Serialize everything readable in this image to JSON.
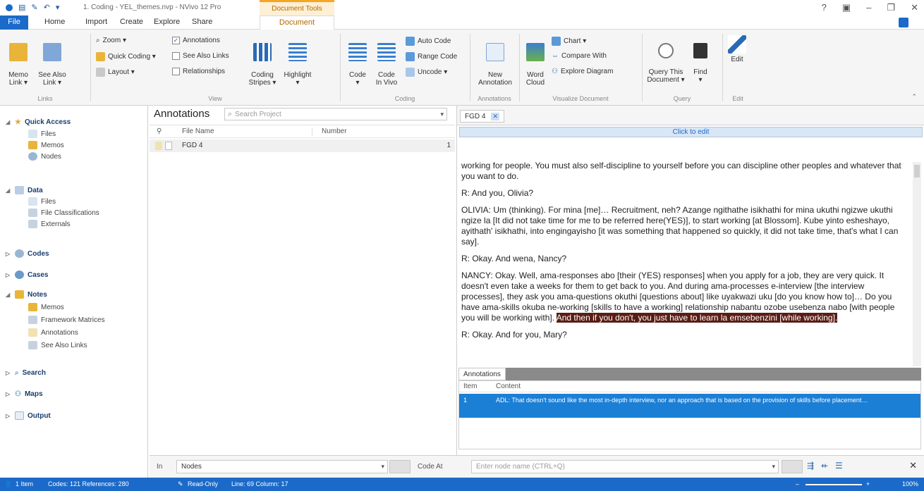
{
  "window": {
    "document_title": "1. Coding - YEL_themes.nvp - NVivo 12 Pro",
    "context_tab": "Document Tools"
  },
  "menu": {
    "file": "File",
    "tabs": [
      "Home",
      "Import",
      "Create",
      "Explore",
      "Share",
      "Document"
    ]
  },
  "ribbon": {
    "links": {
      "memo_link": "Memo\nLink ▾",
      "see_also_link": "See Also\nLink ▾",
      "group": "Links"
    },
    "view": {
      "zoom": "Zoom ▾",
      "quick_coding": "Quick Coding ▾",
      "layout": "Layout ▾",
      "annotations": "Annotations",
      "see_also_links": "See Also Links",
      "relationships": "Relationships",
      "coding_stripes": "Coding\nStripes ▾",
      "highlight": "Highlight\n▾",
      "group": "View"
    },
    "coding": {
      "code": "Code\n▾",
      "code_in_vivo": "Code\nIn Vivo",
      "auto_code": "Auto Code",
      "range_code": "Range Code",
      "uncode": "Uncode ▾",
      "group": "Coding"
    },
    "annotations": {
      "new_annotation": "New\nAnnotation",
      "group": "Annotations"
    },
    "visualize": {
      "word_cloud": "Word\nCloud",
      "chart": "Chart ▾",
      "compare_with": "Compare With",
      "explore_diagram": "Explore Diagram",
      "group": "Visualize Document"
    },
    "query": {
      "query_this_document": "Query This\nDocument ▾",
      "find": "Find\n▾",
      "group": "Query"
    },
    "edit": {
      "edit": "Edit",
      "group": "Edit"
    }
  },
  "nav": {
    "quick_access": {
      "label": "Quick Access",
      "items": [
        "Files",
        "Memos",
        "Nodes"
      ]
    },
    "data": {
      "label": "Data",
      "items": [
        "Files",
        "File Classifications",
        "Externals"
      ]
    },
    "codes": "Codes",
    "cases": "Cases",
    "notes": {
      "label": "Notes",
      "items": [
        "Memos",
        "Framework Matrices",
        "Annotations",
        "See Also Links"
      ]
    },
    "search": "Search",
    "maps": "Maps",
    "output": "Output"
  },
  "list": {
    "title": "Annotations",
    "search_placeholder": "Search Project",
    "columns": {
      "file_name": "File Name",
      "number": "Number"
    },
    "rows": [
      {
        "name": "FGD 4",
        "number": "1"
      }
    ]
  },
  "detail": {
    "tab": "FGD 4",
    "click_to_edit": "Click to edit",
    "paragraphs": [
      "working for people. You must also self-discipline to yourself before you can discipline other peoples and whatever that you want to do.",
      "R: And you, Olivia?",
      "OLIVIA: Um (thinking). For mina [me]… Recruitment, neh? Azange ngithathe isikhathi for mina ukuthi ngizwe ukuthi ngize la [It did not take time for me to be referred here(YES)], to start working [at Blossom]. Kube yinto esheshayo, ayithath' isikhathi, into engingayisho [it was something that happened so quickly, it did not take time, that's what I can say].",
      "R: Okay. And wena, Nancy?"
    ],
    "nancy_text": "NANCY: Okay. Well, ama-responses abo [their (YES) responses] when you apply for a job, they are very quick. It doesn't even take a weeks for them to get back to you. And during ama-processes e-interview [the interview processes], they ask you ama-questions okuthi [questions about] like uyakwazi uku [do you know how to]… Do you have ama-skills okuba ne-working [skills to have a working] relationship nabantu ozobe usebenza nabo [with people you will be working with].",
    "highlighted_text": "And then if you don't, you just have to learn la emsebenzini [while working].",
    "cut_line": "R: Okay. And for you, Mary?",
    "annotations_tab": "Annotations",
    "ann_columns": {
      "item": "Item",
      "content": "Content"
    },
    "ann_rows": [
      {
        "item": "1",
        "content": "ADL: That doesn't sound like the most in-depth interview, nor an approach that is based on the provision of skills before placement…"
      }
    ]
  },
  "bottom": {
    "in_label": "In",
    "in_value": "Nodes",
    "code_at": "Code At",
    "code_placeholder": "Enter node name (CTRL+Q)"
  },
  "status": {
    "items": "1 Item",
    "codes": "Codes: 121  References: 280",
    "readonly": "Read-Only",
    "line": "Line: 69  Column: 17",
    "zoom": "100%"
  }
}
